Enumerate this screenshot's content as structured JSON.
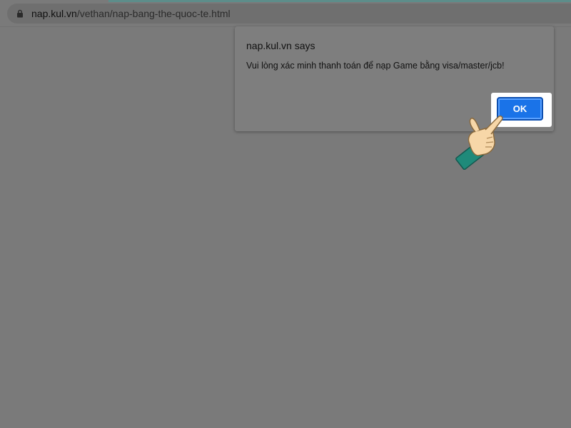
{
  "browser": {
    "url_host": "nap.kul.vn",
    "url_path": "/vethan/nap-bang-the-quoc-te.html"
  },
  "dialog": {
    "title": "nap.kul.vn says",
    "message": "Vui lòng xác minh thanh toán để nạp Game bằng visa/master/jcb!",
    "ok_label": "OK"
  },
  "colors": {
    "overlay_gray": "#7a7a7a",
    "ok_button_blue": "#1a73e8",
    "highlight_white": "#ffffff",
    "hand_cuff_teal": "#1f8a7a",
    "hand_skin": "#f7d7a8"
  },
  "icons": {
    "lock": "lock-icon",
    "pointer": "hand-pointer-icon"
  }
}
